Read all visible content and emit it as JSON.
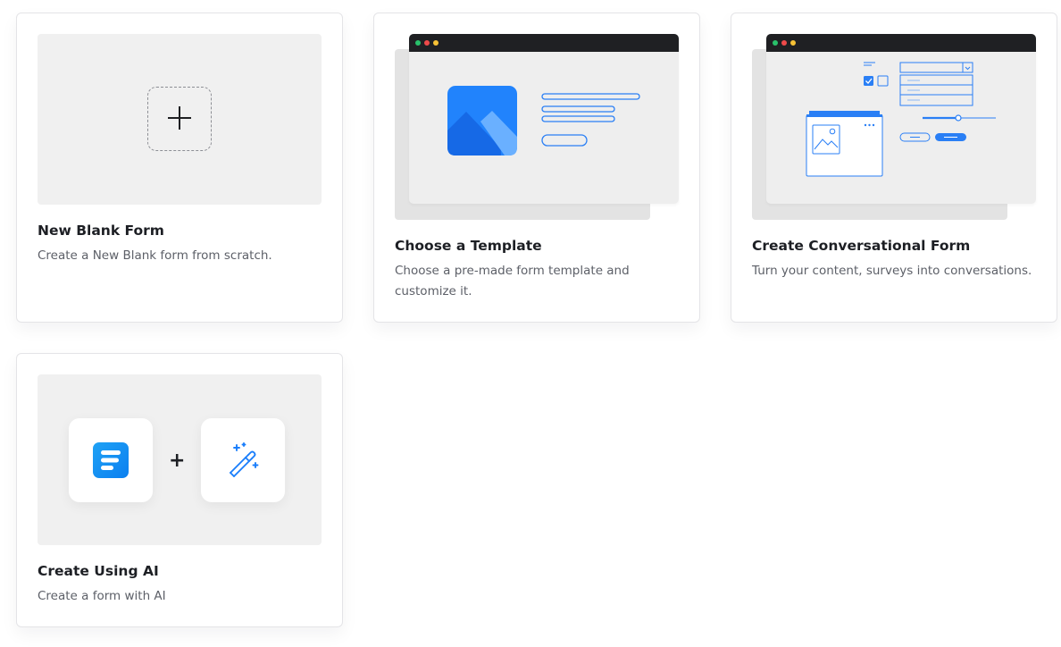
{
  "cards": [
    {
      "title": "New Blank Form",
      "description": "Create a New Blank form from scratch.",
      "icon": "plus-icon"
    },
    {
      "title": "Choose a Template",
      "description": "Choose a pre-made form template and customize it.",
      "icon": "image-placeholder-icon"
    },
    {
      "title": "Create Conversational Form",
      "description": "Turn your content, surveys into conversations.",
      "icon": "conversational-form-illustration"
    },
    {
      "title": "Create Using AI",
      "description": "Create a form with AI",
      "icon": "magic-wand-icon"
    }
  ],
  "colors": {
    "accent": "#1a7efb",
    "card_border": "#e4e4e7",
    "thumb_bg": "#f0f0f0",
    "title_text": "#1d1f24",
    "desc_text": "#5d6068"
  }
}
